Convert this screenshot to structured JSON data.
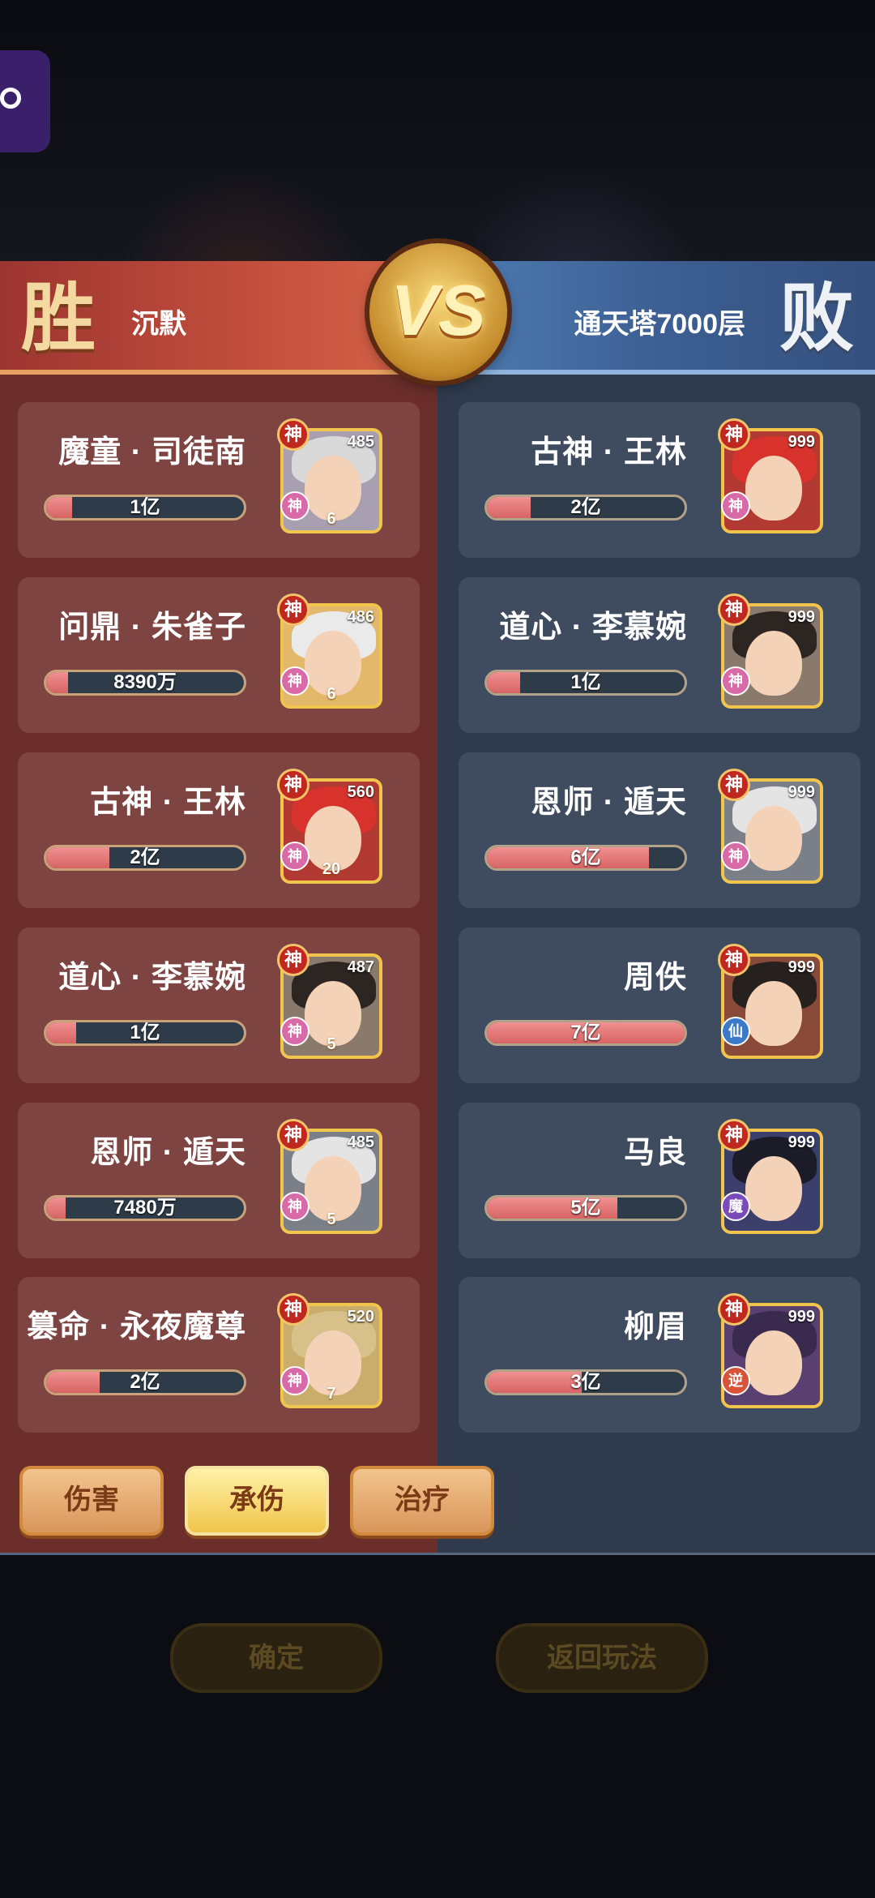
{
  "banner": {
    "win_label": "胜",
    "lose_label": "败",
    "left_player": "沉默",
    "right_player": "通天塔7000层",
    "vs": "VS"
  },
  "left_team": [
    {
      "name": "魔童 · 司徒南",
      "value": "1亿",
      "fill": 0.13,
      "level": "485",
      "badge": "神",
      "sub": "神",
      "star": "6",
      "hair": "#d9d9d9",
      "bg": "#a8a0b0"
    },
    {
      "name": "问鼎 · 朱雀子",
      "value": "8390万",
      "fill": 0.11,
      "level": "486",
      "badge": "神",
      "sub": "神",
      "star": "6",
      "hair": "#eaeaea",
      "bg": "#e3b86a"
    },
    {
      "name": "古神 · 王林",
      "value": "2亿",
      "fill": 0.32,
      "level": "560",
      "badge": "神",
      "sub": "神",
      "star": "20",
      "hair": "#d8322c",
      "bg": "#b23a32"
    },
    {
      "name": "道心 · 李慕婉",
      "value": "1亿",
      "fill": 0.15,
      "level": "487",
      "badge": "神",
      "sub": "神",
      "star": "5",
      "hair": "#2d2522",
      "bg": "#8a7a6c"
    },
    {
      "name": "恩师 · 遁天",
      "value": "7480万",
      "fill": 0.1,
      "level": "485",
      "badge": "神",
      "sub": "神",
      "star": "5",
      "hair": "#e4e4e4",
      "bg": "#7a7f88"
    },
    {
      "name": "篡命 · 永夜魔尊",
      "value": "2亿",
      "fill": 0.27,
      "level": "520",
      "badge": "神",
      "sub": "神",
      "star": "7",
      "hair": "#d8c08a",
      "bg": "#c8ae6a"
    }
  ],
  "right_team": [
    {
      "name": "古神 · 王林",
      "value": "2亿",
      "fill": 0.22,
      "level": "999",
      "badge": "神",
      "sub": "神",
      "hair": "#d8322c",
      "bg": "#b23a32"
    },
    {
      "name": "道心 · 李慕婉",
      "value": "1亿",
      "fill": 0.17,
      "level": "999",
      "badge": "神",
      "sub": "神",
      "hair": "#2d2522",
      "bg": "#8a7a6c"
    },
    {
      "name": "恩师 · 遁天",
      "value": "6亿",
      "fill": 0.82,
      "level": "999",
      "badge": "神",
      "sub": "神",
      "hair": "#e4e4e4",
      "bg": "#7a7f88"
    },
    {
      "name": "周佚",
      "value": "7亿",
      "fill": 1.0,
      "level": "999",
      "badge": "神",
      "sub": "仙",
      "hair": "#26201e",
      "bg": "#8a4a3a"
    },
    {
      "name": "马良",
      "value": "5亿",
      "fill": 0.66,
      "level": "999",
      "badge": "神",
      "sub": "魔",
      "hair": "#1c1c28",
      "bg": "#3c3f6c"
    },
    {
      "name": "柳眉",
      "value": "3亿",
      "fill": 0.48,
      "level": "999",
      "badge": "神",
      "sub": "逆",
      "hair": "#3a2a4e",
      "bg": "#5a4070"
    }
  ],
  "tabs": {
    "damage": "伤害",
    "taken": "承伤",
    "heal": "治疗"
  },
  "actions": {
    "confirm": "确定",
    "back": "返回玩法"
  },
  "colors": {
    "win_red": "#c4503e",
    "lose_blue": "#3d5f93",
    "bar_fill": "#e07070",
    "gold": "#f1c44c"
  }
}
